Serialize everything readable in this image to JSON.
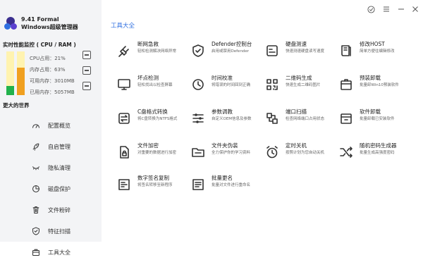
{
  "app": {
    "version": "9.41 Formal",
    "name": "Windows超级管理器"
  },
  "monitor": {
    "title": "实时性能监控 ( CPU / RAM )",
    "cpu_label": "CPU占用：21%",
    "mem_label": "内存占用：63%",
    "avail_label": "可用内存：3010MB",
    "used_label": "已用内存：5057MB",
    "cpu_percent": 21,
    "mem_percent": 63,
    "cpu_color": "#22b24c",
    "mem_color": "#f0a020",
    "track_color": "#fff3b0"
  },
  "world_title": "更大的世界",
  "nav": [
    {
      "label": "配置概览",
      "icon": "gauge-icon"
    },
    {
      "label": "自启管理",
      "icon": "rocket-icon"
    },
    {
      "label": "隐私清理",
      "icon": "eye-closed-icon"
    },
    {
      "label": "磁盘保护",
      "icon": "pie-chart-icon"
    },
    {
      "label": "文件粉碎",
      "icon": "trash-icon"
    },
    {
      "label": "特征扫描",
      "icon": "shield-icon"
    },
    {
      "label": "工具大全",
      "icon": "briefcase-icon",
      "active": true
    }
  ],
  "main": {
    "title": "工具大全"
  },
  "tools": [
    {
      "name": "断网急救",
      "desc": "轻松检测解决网络异常",
      "icon": "plug-icon"
    },
    {
      "name": "Defender控制台",
      "desc": "启用或禁用Defender",
      "icon": "shield-icon"
    },
    {
      "name": "硬盘测速",
      "desc": "快速测速硬盘读写速度",
      "icon": "disk-icon"
    },
    {
      "name": "修改HOST",
      "desc": "简单方便往编辑修改",
      "icon": "book-icon"
    },
    {
      "name": "坏点检测",
      "desc": "轻松找出以检查屏幕",
      "icon": "monitor-icon"
    },
    {
      "name": "时间校准",
      "desc": "将错误的时间回到正确",
      "icon": "clock-icon"
    },
    {
      "name": "二维码生成",
      "desc": "快速生成二维码图片",
      "icon": "qrcode-icon"
    },
    {
      "name": "预装卸载",
      "desc": "批量卸Win10预装软件",
      "icon": "package-icon"
    },
    {
      "name": "C盘格式转换",
      "desc": "将C盘转换为NTFS格式",
      "icon": "convert-icon"
    },
    {
      "name": "参数调教",
      "desc": "自定义OEM信息及参数",
      "icon": "sliders-icon"
    },
    {
      "name": "端口扫描",
      "desc": "检查网络端口占用状态",
      "icon": "network-icon"
    },
    {
      "name": "软件卸载",
      "desc": "批量卸载已安装软件",
      "icon": "uninstall-icon"
    },
    {
      "name": "文件加密",
      "desc": "对重要的数据进行加密",
      "icon": "lock-file-icon"
    },
    {
      "name": "文件夹伪装",
      "desc": "全力保护你的学习资料",
      "icon": "folder-icon"
    },
    {
      "name": "定时关机",
      "desc": "按照计划为您自动关机",
      "icon": "alarm-icon"
    },
    {
      "name": "随机密码生成器",
      "desc": "批量生成高强度密码",
      "icon": "shuffle-icon"
    },
    {
      "name": "数字签名复制",
      "desc": "将签名转移至新程序",
      "icon": "signature-icon"
    },
    {
      "name": "批量更名",
      "desc": "批量对文件进行重命名",
      "icon": "rename-icon"
    }
  ],
  "window_controls": [
    "check-circle-icon",
    "menu-icon",
    "minimize-icon",
    "close-icon"
  ]
}
